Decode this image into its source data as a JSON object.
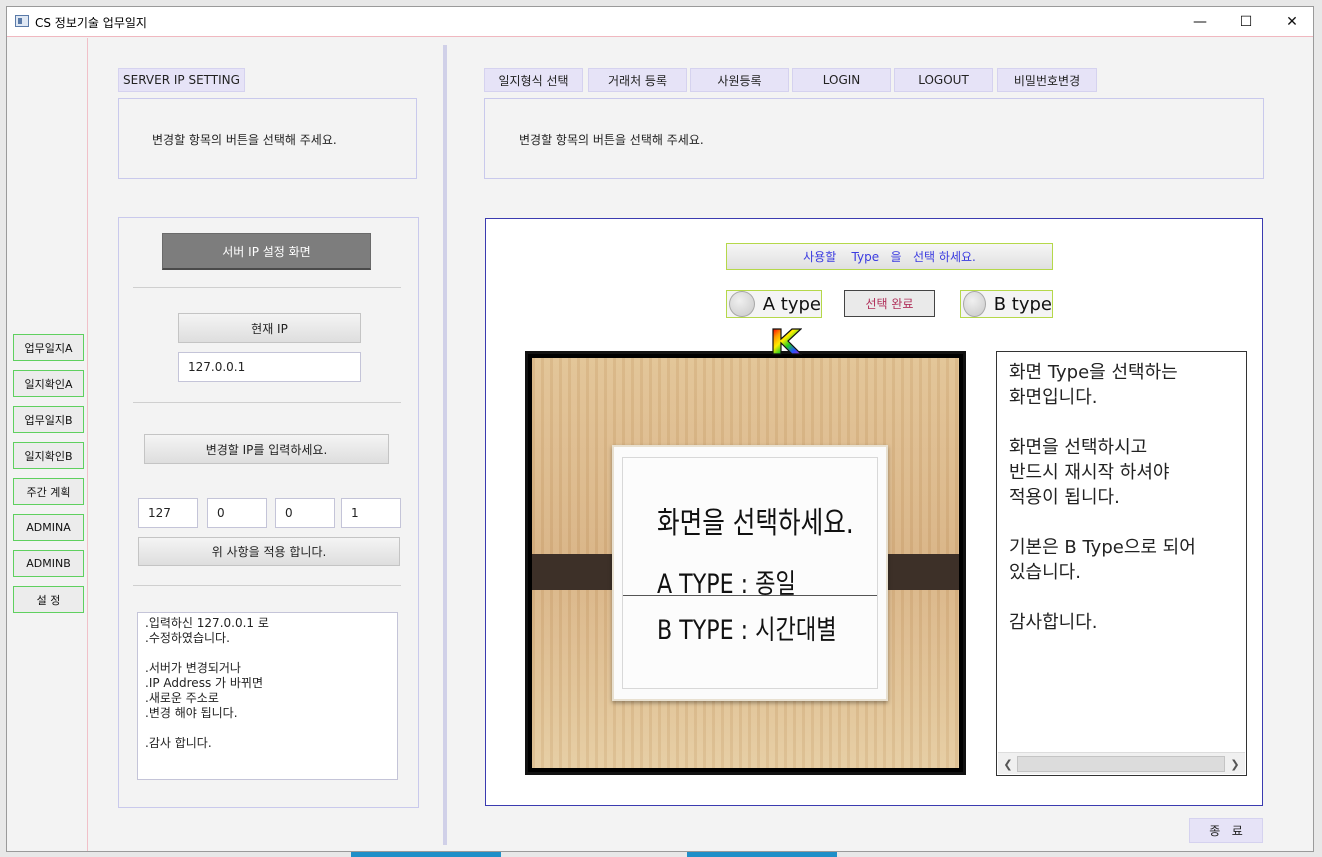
{
  "window": {
    "title": "CS 정보기술 업무일지",
    "controls": {
      "minimize": "—",
      "maximize": "☐",
      "close": "✕"
    }
  },
  "sidebar": {
    "items": [
      {
        "label": "업무일지A"
      },
      {
        "label": "일지확인A"
      },
      {
        "label": "업무일지B"
      },
      {
        "label": "일지확인B"
      },
      {
        "label": "주간 계획"
      },
      {
        "label": "ADMINA"
      },
      {
        "label": "ADMINB"
      },
      {
        "label": "설   정"
      }
    ]
  },
  "left_panel": {
    "tab_label": "SERVER IP SETTING",
    "message": "변경할 항목의 버튼을 선택해 주세요.",
    "screen_title": "서버 IP 설정 화면",
    "current_ip_label": "현재  IP",
    "current_ip_value": "127.0.0.1",
    "new_ip_label": "변경할 IP를 입력하세요.",
    "ip_octets": [
      "127",
      "0",
      "0",
      "1"
    ],
    "apply_label": "위 사항을 적용 합니다.",
    "memo_text": ".입력하신 127.0.0.1 로\n.수정하였습니다.\n\n.서버가 변경되거나\n.IP Address 가 바뀌면\n.새로운 주소로\n.변경 해야 됩니다.\n\n.감사 합니다."
  },
  "top_tabs": [
    {
      "label": "일지형식 선택"
    },
    {
      "label": "거래처 등록"
    },
    {
      "label": "사원등록"
    },
    {
      "label": "LOGIN"
    },
    {
      "label": "LOGOUT"
    },
    {
      "label": "비밀번호변경"
    }
  ],
  "right_panel": {
    "message": "변경할 항목의 버튼을 선택해 주세요.",
    "type_header": "사용할    Type   을   선택 하세요.",
    "option_a": "A type",
    "option_b": "B type",
    "select_done": "선택 완료",
    "picture": {
      "line1": "화면을 선택하세요.",
      "line2": "A TYPE : 종일",
      "line3": "B TYPE : 시간대별"
    },
    "description": "화면 Type을 선택하는\n화면입니다.\n\n화면을 선택하시고\n반드시 재시작 하셔야\n적용이 됩니다.\n\n기본은 B Type으로 되어\n있습니다.\n\n감사합니다.",
    "close_label": "종   료"
  },
  "colors": {
    "accent_border": "#b5d84a",
    "tab_bg": "#e6e3f7",
    "header_text": "#3b3be0",
    "select_done_text": "#b0305a",
    "nav_border": "#5fd05f"
  }
}
